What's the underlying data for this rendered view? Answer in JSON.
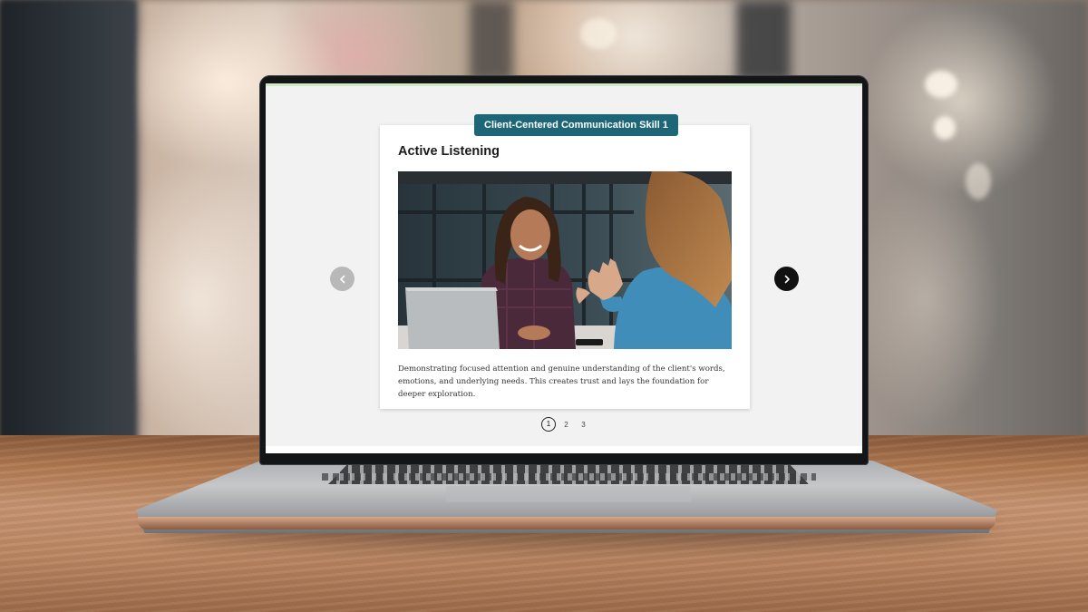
{
  "slide": {
    "badge": "Client-Centered Communication Skill 1",
    "title": "Active Listening",
    "description": "Demonstrating focused attention and genuine understanding of the client's words, emotions, and underlying needs. This creates trust and lays the foundation for deeper exploration."
  },
  "navigation": {
    "prev_icon": "chevron-left-icon",
    "next_icon": "chevron-right-icon",
    "pages": [
      "1",
      "2",
      "3"
    ],
    "current_page": 1
  },
  "colors": {
    "badge": "#1d6678",
    "next_button": "#111111",
    "prev_button": "#b8b8b8"
  }
}
